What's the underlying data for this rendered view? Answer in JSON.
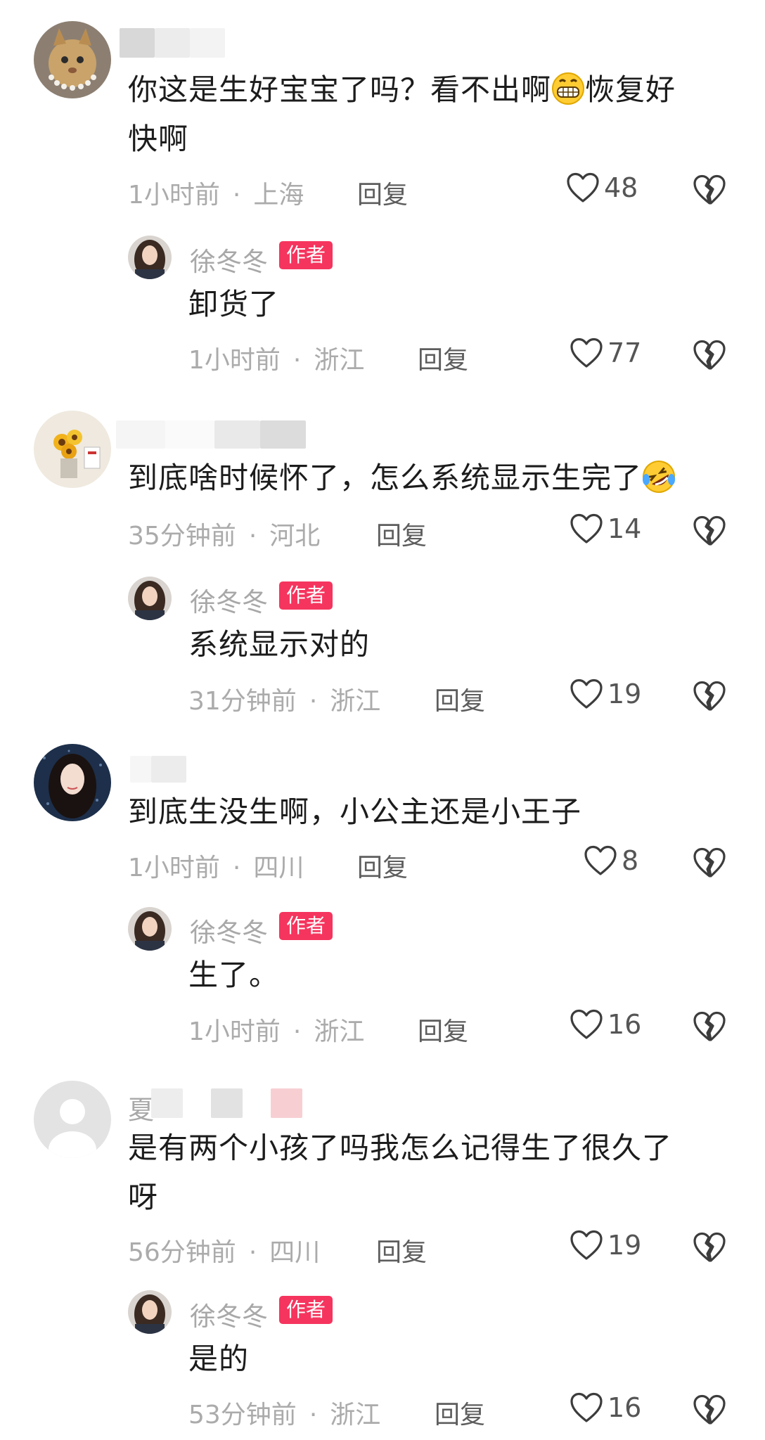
{
  "threads": [
    {
      "comment": {
        "author_blurred": true,
        "text_before_emoji": "你这是生好宝宝了吗？看不出啊",
        "emoji": "grin-emoji",
        "text_after_emoji": "恢复好",
        "text_line2": "快啊",
        "time": "1小时前",
        "location": "上海",
        "reply_label": "回复",
        "likes": "48"
      },
      "reply": {
        "author": "徐冬冬",
        "badge": "作者",
        "text": "卸货了",
        "time": "1小时前",
        "location": "浙江",
        "reply_label": "回复",
        "likes": "77"
      }
    },
    {
      "comment": {
        "author_blurred": true,
        "text": "到底啥时候怀了，怎么系统显示生完了",
        "emoji": "rolling-laugh-emoji",
        "time": "35分钟前",
        "location": "河北",
        "reply_label": "回复",
        "likes": "14"
      },
      "reply": {
        "author": "徐冬冬",
        "badge": "作者",
        "text": "系统显示对的",
        "time": "31分钟前",
        "location": "浙江",
        "reply_label": "回复",
        "likes": "19"
      }
    },
    {
      "comment": {
        "author_blurred": true,
        "text": "到底生没生啊，小公主还是小王子",
        "time": "1小时前",
        "location": "四川",
        "reply_label": "回复",
        "likes": "8"
      },
      "reply": {
        "author": "徐冬冬",
        "badge": "作者",
        "text": "生了。",
        "time": "1小时前",
        "location": "浙江",
        "reply_label": "回复",
        "likes": "16"
      }
    },
    {
      "comment": {
        "author_prefix": "夏",
        "text": "是有两个小孩了吗我怎么记得生了很久了",
        "text_line2": "呀",
        "time": "56分钟前",
        "location": "四川",
        "reply_label": "回复",
        "likes": "19"
      },
      "reply": {
        "author": "徐冬冬",
        "badge": "作者",
        "text": "是的",
        "time": "53分钟前",
        "location": "浙江",
        "reply_label": "回复",
        "likes": "16"
      }
    }
  ],
  "colors": {
    "badge": "#f5355e",
    "meta": "#ababab",
    "text": "#1c1c1c"
  }
}
